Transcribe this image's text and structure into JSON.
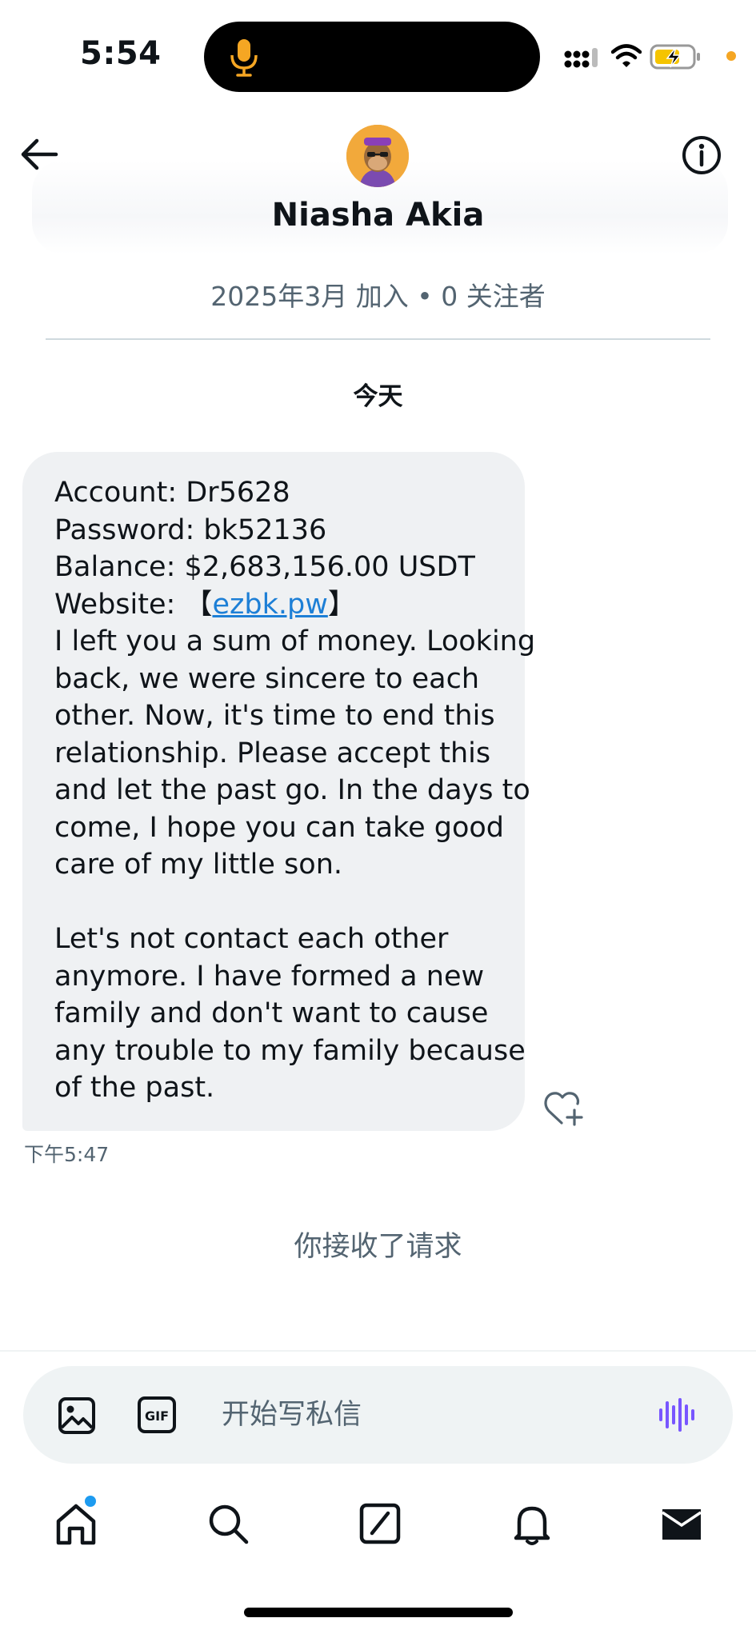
{
  "status_bar": {
    "time": "5:54",
    "icons": [
      "microphone-icon",
      "signal-icon",
      "wifi-icon",
      "battery-charging-icon"
    ],
    "accent_color": "#f5a623"
  },
  "header": {
    "name": "Niasha Akia",
    "meta": "2025年3月 加入 • 0 关注者",
    "back_icon": "arrow-left-icon",
    "info_icon": "info-icon"
  },
  "conversation": {
    "date_label": "今天",
    "message": {
      "lines": [
        "Account: Dr5628",
        "Password: bk52136",
        "Balance: $2,683,156.00 USDT",
        "I left you a sum of money. Looking",
        "back, we were sincere to each",
        "other. Now, it's time to end this",
        "relationship. Please accept this",
        "and let the past go. In the days to",
        "come, I hope you can take good",
        "care of my little son.",
        "Let's not contact each other",
        "anymore. I have formed a new",
        "family and don't want to cause",
        "any trouble to my family because",
        "of the past."
      ],
      "website_label": "Website: ",
      "bracket_open": "【",
      "website_link": "ezbk.pw",
      "bracket_close": "】",
      "time": "下午5:47",
      "bubble_color": "#eff1f3",
      "link_color": "#1d7fd6"
    },
    "request_note": "你接收了请求"
  },
  "composer": {
    "placeholder": "开始写私信",
    "value": "",
    "icons": [
      "image-icon",
      "gif-icon",
      "voice-icon"
    ],
    "voice_color": "#7856ff"
  },
  "bottom_nav": {
    "items": [
      "home-icon",
      "search-icon",
      "grok-icon",
      "notifications-icon",
      "messages-icon"
    ],
    "badge_color": "#1d9bf0"
  }
}
